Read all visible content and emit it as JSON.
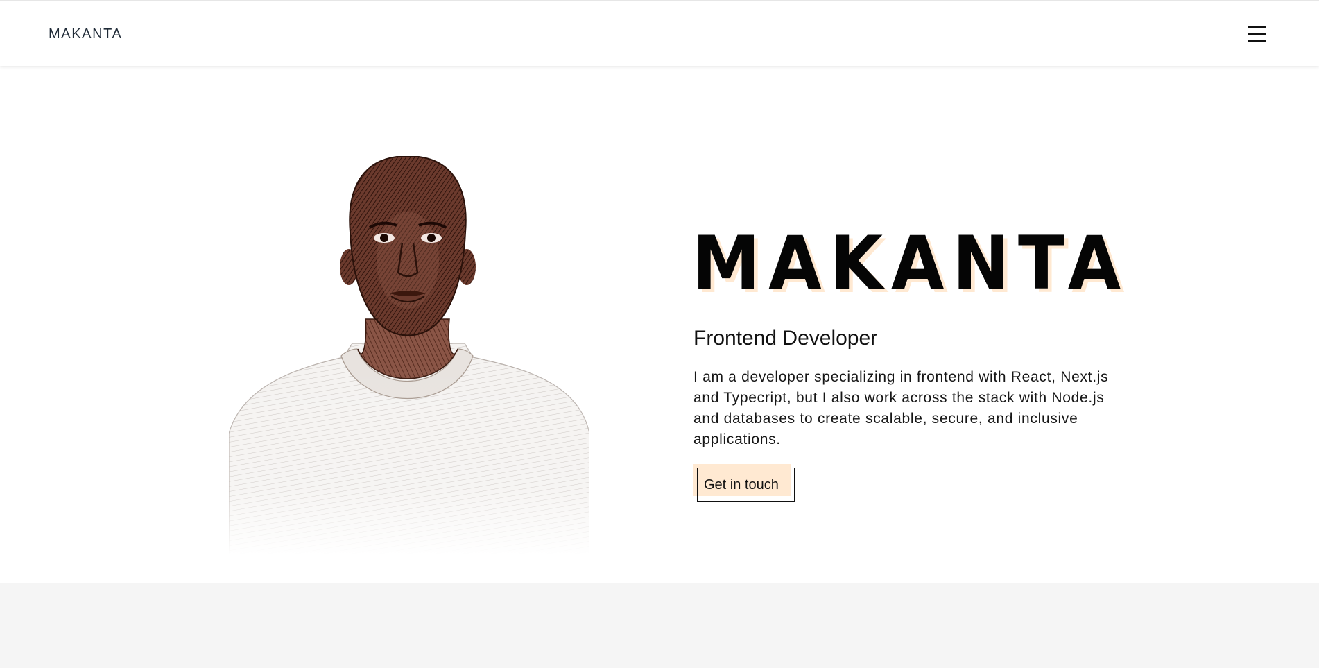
{
  "nav": {
    "brand": "MAKANTA",
    "menu_icon": "hamburger-menu-icon"
  },
  "hero": {
    "portrait_icon": "portrait-illustration",
    "title": "MAKANTA",
    "role": "Frontend Developer",
    "description": "I am a developer specializing in frontend with React, Next.js and Typecript, but I also work across the stack with Node.js and databases to create scalable, secure, and inclusive applications.",
    "cta_label": "Get in touch"
  },
  "colors": {
    "accent": "#ffe9d2",
    "portrait_ink": "#5a2d22",
    "lower_section_bg": "#f5f5f5"
  }
}
